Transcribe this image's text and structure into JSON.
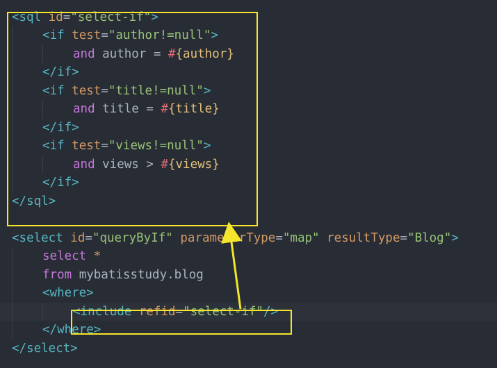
{
  "editor": {
    "accent": "#f5e52b",
    "lines": [
      {
        "indent": 0,
        "tokens": [
          {
            "c": "t",
            "v": "<sql "
          },
          {
            "c": "a",
            "v": "id"
          },
          {
            "c": "p",
            "v": "="
          },
          {
            "c": "s",
            "v": "\"select-if\""
          },
          {
            "c": "t",
            "v": ">"
          }
        ]
      },
      {
        "indent": 1,
        "tokens": [
          {
            "c": "t",
            "v": "<if "
          },
          {
            "c": "a",
            "v": "test"
          },
          {
            "c": "p",
            "v": "="
          },
          {
            "c": "s",
            "v": "\"author!=null\""
          },
          {
            "c": "t",
            "v": ">"
          }
        ]
      },
      {
        "indent": 2,
        "tokens": [
          {
            "c": "k",
            "v": "and"
          },
          {
            "c": "p",
            "v": " author = "
          },
          {
            "c": "i",
            "v": "#"
          },
          {
            "c": "b",
            "v": "{author}"
          }
        ]
      },
      {
        "indent": 1,
        "tokens": [
          {
            "c": "t",
            "v": "</if>"
          }
        ]
      },
      {
        "indent": 1,
        "tokens": [
          {
            "c": "t",
            "v": "<if "
          },
          {
            "c": "a",
            "v": "test"
          },
          {
            "c": "p",
            "v": "="
          },
          {
            "c": "s",
            "v": "\"title!=null\""
          },
          {
            "c": "t",
            "v": ">"
          }
        ]
      },
      {
        "indent": 2,
        "tokens": [
          {
            "c": "k",
            "v": "and"
          },
          {
            "c": "p",
            "v": " title = "
          },
          {
            "c": "i",
            "v": "#"
          },
          {
            "c": "b",
            "v": "{title}"
          }
        ]
      },
      {
        "indent": 1,
        "tokens": [
          {
            "c": "t",
            "v": "</if>"
          }
        ]
      },
      {
        "indent": 1,
        "tokens": [
          {
            "c": "t",
            "v": "<if "
          },
          {
            "c": "a",
            "v": "test"
          },
          {
            "c": "p",
            "v": "="
          },
          {
            "c": "s",
            "v": "\"views!=null\""
          },
          {
            "c": "t",
            "v": ">"
          }
        ]
      },
      {
        "indent": 2,
        "tokens": [
          {
            "c": "k",
            "v": "and"
          },
          {
            "c": "p",
            "v": " views > "
          },
          {
            "c": "i",
            "v": "#"
          },
          {
            "c": "b",
            "v": "{views}"
          }
        ]
      },
      {
        "indent": 1,
        "tokens": [
          {
            "c": "t",
            "v": "</if>"
          }
        ]
      },
      {
        "indent": 0,
        "tokens": [
          {
            "c": "t",
            "v": "</sql>"
          }
        ]
      },
      {
        "indent": 0,
        "tokens": []
      },
      {
        "indent": 0,
        "tokens": [
          {
            "c": "t",
            "v": "<select "
          },
          {
            "c": "a",
            "v": "id"
          },
          {
            "c": "p",
            "v": "="
          },
          {
            "c": "s",
            "v": "\"queryByIf\""
          },
          {
            "c": "p",
            "v": " "
          },
          {
            "c": "a",
            "v": "parameterType"
          },
          {
            "c": "p",
            "v": "="
          },
          {
            "c": "s",
            "v": "\"map\""
          },
          {
            "c": "p",
            "v": " "
          },
          {
            "c": "a",
            "v": "resultType"
          },
          {
            "c": "p",
            "v": "="
          },
          {
            "c": "s",
            "v": "\"Blog\""
          },
          {
            "c": "t",
            "v": ">"
          }
        ]
      },
      {
        "indent": 1,
        "tokens": [
          {
            "c": "k",
            "v": "select"
          },
          {
            "c": "p",
            "v": " "
          },
          {
            "c": "a",
            "v": "*"
          }
        ]
      },
      {
        "indent": 1,
        "tokens": [
          {
            "c": "k",
            "v": "from"
          },
          {
            "c": "p",
            "v": " mybatisstudy.blog"
          }
        ]
      },
      {
        "indent": 1,
        "tokens": [
          {
            "c": "t",
            "v": "<where>"
          }
        ]
      },
      {
        "indent": 2,
        "cursor": true,
        "tokens": [
          {
            "c": "t",
            "v": "<include "
          },
          {
            "c": "a",
            "v": "refid"
          },
          {
            "c": "p",
            "v": "="
          },
          {
            "c": "s",
            "v": "\"select-if\""
          },
          {
            "c": "t",
            "v": "/>"
          }
        ]
      },
      {
        "indent": 1,
        "tokens": [
          {
            "c": "t",
            "v": "</where>"
          }
        ]
      },
      {
        "indent": 0,
        "tokens": [
          {
            "c": "t",
            "v": "</select>"
          }
        ]
      }
    ]
  }
}
